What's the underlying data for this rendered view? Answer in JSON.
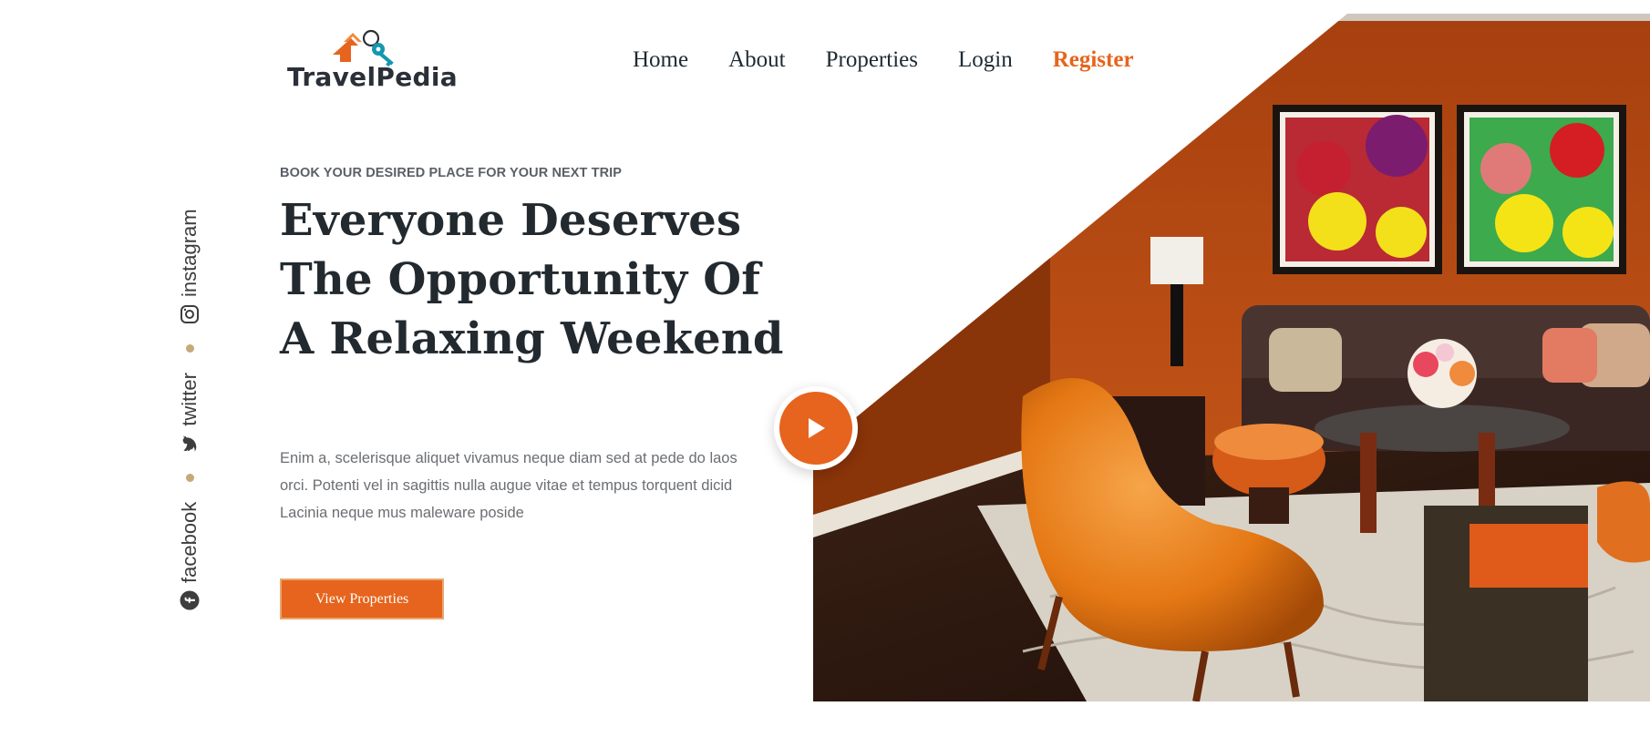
{
  "brand": {
    "name": "TravelPedia",
    "accent_color": "#e6641d",
    "secondary_color": "#1497b0"
  },
  "nav": {
    "items": [
      "Home",
      "About",
      "Properties",
      "Login"
    ],
    "register_label": "Register"
  },
  "social": {
    "items": [
      {
        "label": "facebook",
        "icon": "facebook-icon"
      },
      {
        "label": "twitter",
        "icon": "twitter-icon"
      },
      {
        "label": "instagram",
        "icon": "instagram-icon"
      }
    ],
    "dot_color": "#c7a877"
  },
  "hero": {
    "eyebrow": "BOOK YOUR DESIRED PLACE FOR YOUR NEXT TRIP",
    "title": "Everyone Deserves The Opportunity Of A Relaxing Weekend",
    "body": "Enim a, scelerisque aliquet vivamus neque diam sed at pede do laos orci. Potenti vel in sagittis nulla augue vitae et tempus torquent dicid Lacinia neque mus maleware poside",
    "cta_label": "View Properties",
    "image_icon": "living-room-photo",
    "play_icon": "play-icon"
  }
}
